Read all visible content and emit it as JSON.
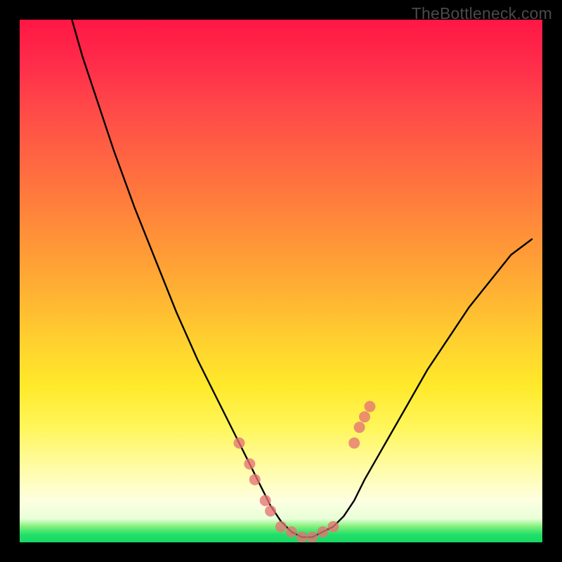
{
  "watermark": "TheBottleneck.com",
  "colors": {
    "frame": "#000000",
    "curve": "#000000",
    "marker_fill": "#e57373",
    "marker_stroke": "#c85a5a"
  },
  "chart_data": {
    "type": "line",
    "title": "",
    "xlabel": "",
    "ylabel": "",
    "xlim": [
      0,
      100
    ],
    "ylim": [
      0,
      100
    ],
    "grid": false,
    "legend": false,
    "note": "V-shaped curve on rainbow background; minimum reaches y≈0 near x≈50–55. Axes unlabeled; values estimated from pixel positions on a 0–100 normalized plot area.",
    "series": [
      {
        "name": "curve",
        "x": [
          10,
          12,
          15,
          18,
          22,
          26,
          30,
          34,
          38,
          42,
          46,
          48,
          50,
          52,
          54,
          56,
          58,
          60,
          62,
          64,
          66,
          70,
          74,
          78,
          82,
          86,
          90,
          94,
          98
        ],
        "y": [
          100,
          93,
          84,
          75,
          64,
          54,
          44,
          35,
          27,
          19,
          11,
          7,
          4,
          2,
          1,
          1,
          2,
          3,
          5,
          8,
          12,
          19,
          26,
          33,
          39,
          45,
          50,
          55,
          58
        ]
      }
    ],
    "markers": [
      {
        "x": 42,
        "y": 19
      },
      {
        "x": 44,
        "y": 15
      },
      {
        "x": 45,
        "y": 12
      },
      {
        "x": 47,
        "y": 8
      },
      {
        "x": 48,
        "y": 6
      },
      {
        "x": 50,
        "y": 3
      },
      {
        "x": 52,
        "y": 2
      },
      {
        "x": 54,
        "y": 1
      },
      {
        "x": 56,
        "y": 1
      },
      {
        "x": 58,
        "y": 2
      },
      {
        "x": 60,
        "y": 3
      },
      {
        "x": 64,
        "y": 19
      },
      {
        "x": 65,
        "y": 22
      },
      {
        "x": 66,
        "y": 24
      },
      {
        "x": 67,
        "y": 26
      }
    ]
  }
}
